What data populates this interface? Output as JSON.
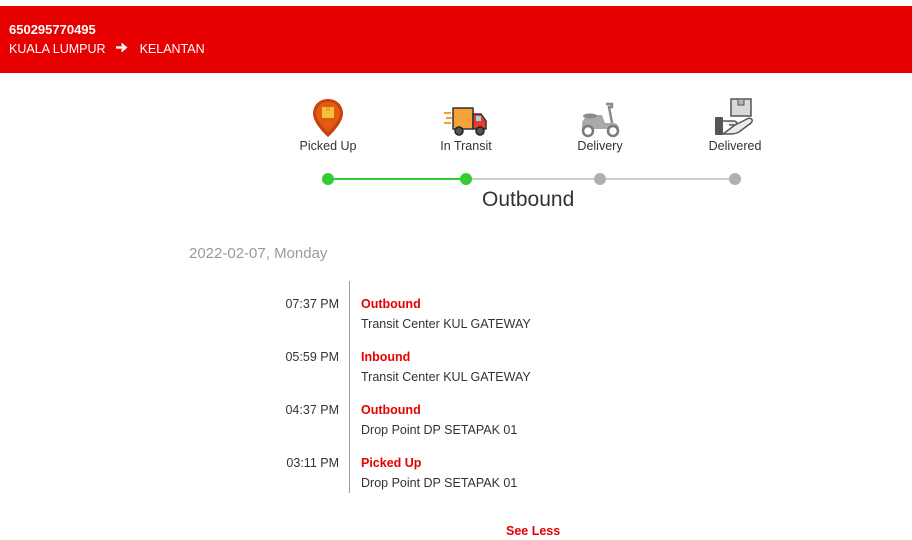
{
  "header": {
    "tracking_number": "650295770495",
    "origin": "KUALA LUMPUR",
    "destination": "KELANTAN"
  },
  "steps": [
    {
      "label": "Picked Up",
      "icon": "location-pin-icon",
      "done": true
    },
    {
      "label": "In Transit",
      "icon": "delivery-truck-icon",
      "done": true
    },
    {
      "label": "Delivery",
      "icon": "scooter-icon",
      "done": false
    },
    {
      "label": "Delivered",
      "icon": "hand-package-icon",
      "done": false
    }
  ],
  "current_status": "Outbound",
  "date": "2022-02-07, Monday",
  "events": [
    {
      "time": "07:37 PM",
      "status": "Outbound",
      "location": "Transit Center KUL GATEWAY"
    },
    {
      "time": "05:59 PM",
      "status": "Inbound",
      "location": "Transit Center KUL GATEWAY"
    },
    {
      "time": "04:37 PM",
      "status": "Outbound",
      "location": "Drop Point DP SETAPAK 01"
    },
    {
      "time": "03:11 PM",
      "status": "Picked Up",
      "location": "Drop Point DP SETAPAK 01"
    }
  ],
  "see_less_label": "See Less",
  "colors": {
    "brand": "#e60000",
    "progress_done": "#33cc33",
    "progress_pending": "#b0b0b0"
  }
}
